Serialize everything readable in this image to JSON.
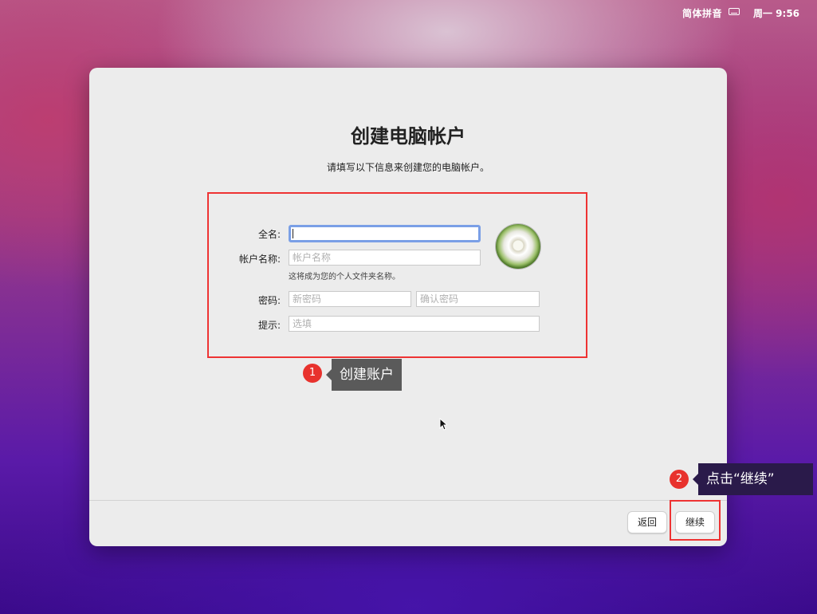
{
  "menubar": {
    "input_method": "简体拼音",
    "keyboard_icon": "keyboard-icon",
    "clock": "周一 9:56"
  },
  "window": {
    "title": "创建电脑帐户",
    "subtitle": "请填写以下信息来创建您的电脑帐户。"
  },
  "form": {
    "full_name": {
      "label": "全名:",
      "value": ""
    },
    "account_name": {
      "label": "帐户名称:",
      "placeholder": "帐户名称",
      "hint": "这将成为您的个人文件夹名称。"
    },
    "password": {
      "label": "密码:",
      "placeholder": "新密码",
      "confirm_placeholder": "确认密码"
    },
    "hint": {
      "label": "提示:",
      "placeholder": "选填"
    }
  },
  "avatar": {
    "icon": "dandelion-avatar"
  },
  "buttons": {
    "back": "返回",
    "continue": "继续"
  },
  "annotations": [
    {
      "number": "1",
      "text": "创建账户"
    },
    {
      "number": "2",
      "text": "点击“继续”"
    }
  ],
  "colors": {
    "highlight": "#e33333",
    "badge": "#e8322d",
    "focus_ring": "#7a9fe6"
  }
}
